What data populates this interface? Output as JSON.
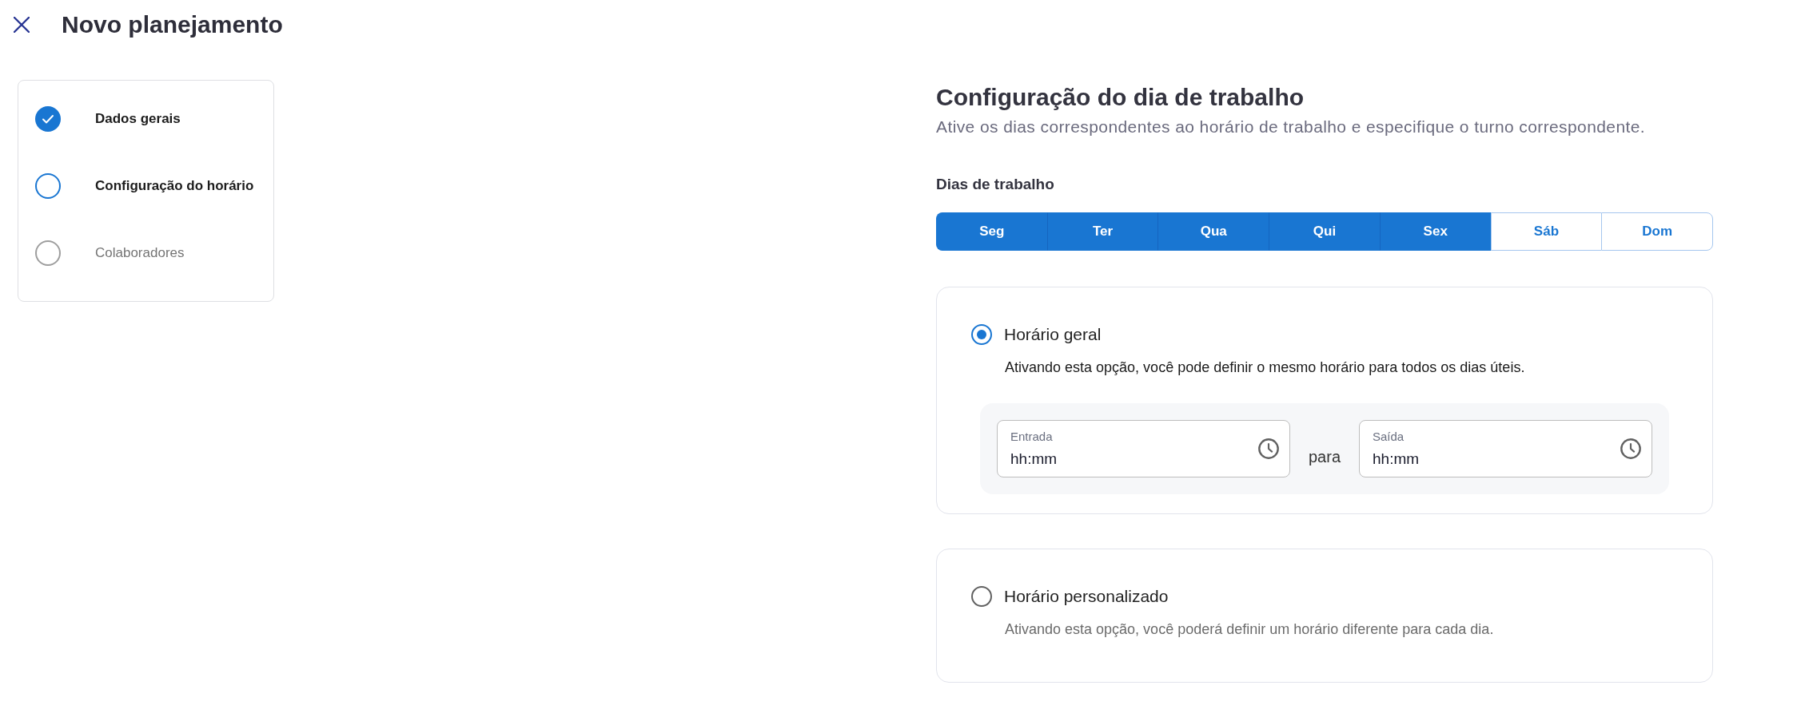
{
  "header": {
    "title": "Novo planejamento"
  },
  "steps": [
    {
      "label": "Dados gerais",
      "kind": "completed"
    },
    {
      "label": "Configuração do horário",
      "kind": "current"
    },
    {
      "label": "Colaboradores",
      "kind": "upcoming"
    }
  ],
  "section": {
    "title": "Configuração do dia de trabalho",
    "subtitle": "Ative os dias correspondentes ao horário de trabalho e especifique o turno correspondente."
  },
  "work_days": {
    "label": "Dias de trabalho",
    "days": [
      {
        "label": "Seg",
        "selected": true
      },
      {
        "label": "Ter",
        "selected": true
      },
      {
        "label": "Qua",
        "selected": true
      },
      {
        "label": "Qui",
        "selected": true
      },
      {
        "label": "Sex",
        "selected": true
      },
      {
        "label": "Sáb",
        "selected": false
      },
      {
        "label": "Dom",
        "selected": false
      }
    ]
  },
  "schedule_options": [
    {
      "label": "Horário geral",
      "description": "Ativando esta opção, você pode definir o mesmo horário para todos os dias úteis.",
      "selected": true,
      "time_range": {
        "start": {
          "label": "Entrada",
          "placeholder": "hh:mm"
        },
        "separator": "para",
        "end": {
          "label": "Saída",
          "placeholder": "hh:mm"
        }
      }
    },
    {
      "label": "Horário personalizado",
      "description": "Ativando esta opção, você poderá definir um horário diferente para cada dia.",
      "selected": false
    }
  ]
}
